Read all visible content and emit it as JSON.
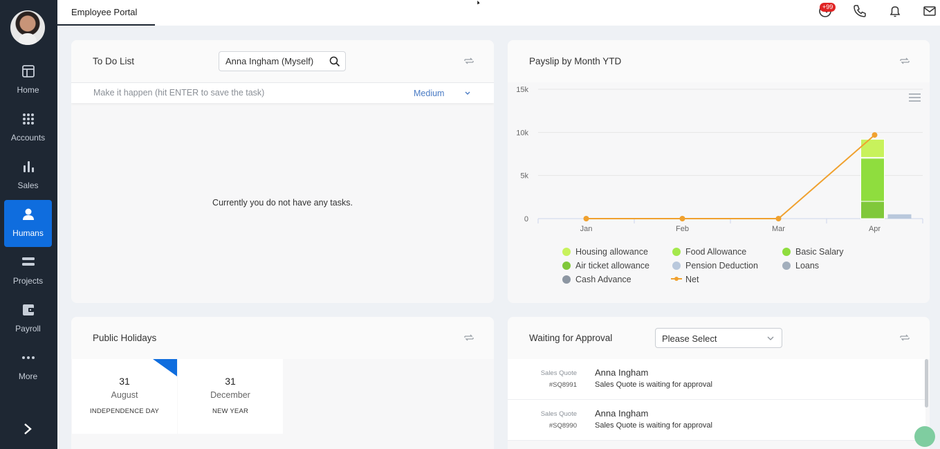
{
  "sidebar": {
    "items": [
      {
        "label": "Home",
        "icon": "home-layout-icon"
      },
      {
        "label": "Accounts",
        "icon": "grid-dots-icon"
      },
      {
        "label": "Sales",
        "icon": "bar-chart-icon"
      },
      {
        "label": "Humans",
        "icon": "person-icon",
        "active": true
      },
      {
        "label": "Projects",
        "icon": "stack-icon"
      },
      {
        "label": "Payroll",
        "icon": "wallet-icon"
      },
      {
        "label": "More",
        "icon": "more-dots-icon"
      }
    ]
  },
  "topbar": {
    "tab_label": "Employee Portal",
    "notification_badge": "+99"
  },
  "todo": {
    "title": "To Do List",
    "assignee": "Anna Ingham (Myself)",
    "task_placeholder": "Make it happen (hit ENTER to save the task)",
    "priority": "Medium",
    "empty_message": "Currently you do not have any tasks."
  },
  "payslip": {
    "title": "Payslip by Month YTD"
  },
  "chart_data": {
    "type": "bar",
    "categories": [
      "Jan",
      "Feb",
      "Mar",
      "Apr"
    ],
    "ylim": [
      0,
      15000
    ],
    "yticks": [
      "0",
      "5k",
      "10k",
      "15k"
    ],
    "stacked": true,
    "series": [
      {
        "name": "Housing allowance",
        "color": "#c8f25c",
        "values": [
          0,
          0,
          0,
          2100
        ]
      },
      {
        "name": "Food Allowance",
        "color": "#a4e84c",
        "values": [
          0,
          0,
          0,
          100
        ]
      },
      {
        "name": "Basic Salary",
        "color": "#8fdd3e",
        "values": [
          0,
          0,
          0,
          5000
        ]
      },
      {
        "name": "Air ticket allowance",
        "color": "#80c83a",
        "values": [
          0,
          0,
          0,
          2000
        ]
      },
      {
        "name": "Pension Deduction",
        "color": "#b9c8dc",
        "values": [
          0,
          0,
          0,
          500
        ]
      },
      {
        "name": "Loans",
        "color": "#a3afbd",
        "values": [
          0,
          0,
          0,
          0
        ]
      },
      {
        "name": "Cash Advance",
        "color": "#8c96a2",
        "values": [
          0,
          0,
          0,
          0
        ]
      },
      {
        "name": "Net",
        "type": "line",
        "color": "#f0a12f",
        "values": [
          0,
          0,
          0,
          9700
        ]
      }
    ],
    "legend_position": "bottom",
    "grid": true
  },
  "holidays": {
    "title": "Public Holidays",
    "items": [
      {
        "day": "31",
        "month": "August",
        "name": "INDEPENDENCE DAY"
      },
      {
        "day": "31",
        "month": "December",
        "name": "NEW YEAR"
      }
    ]
  },
  "approval": {
    "title": "Waiting for Approval",
    "select_value": "Please Select",
    "items": [
      {
        "type": "Sales Quote",
        "ref": "#SQ8991",
        "name": "Anna Ingham",
        "desc": "Sales Quote is waiting for approval"
      },
      {
        "type": "Sales Quote",
        "ref": "#SQ8990",
        "name": "Anna Ingham",
        "desc": "Sales Quote is waiting for approval"
      }
    ]
  }
}
